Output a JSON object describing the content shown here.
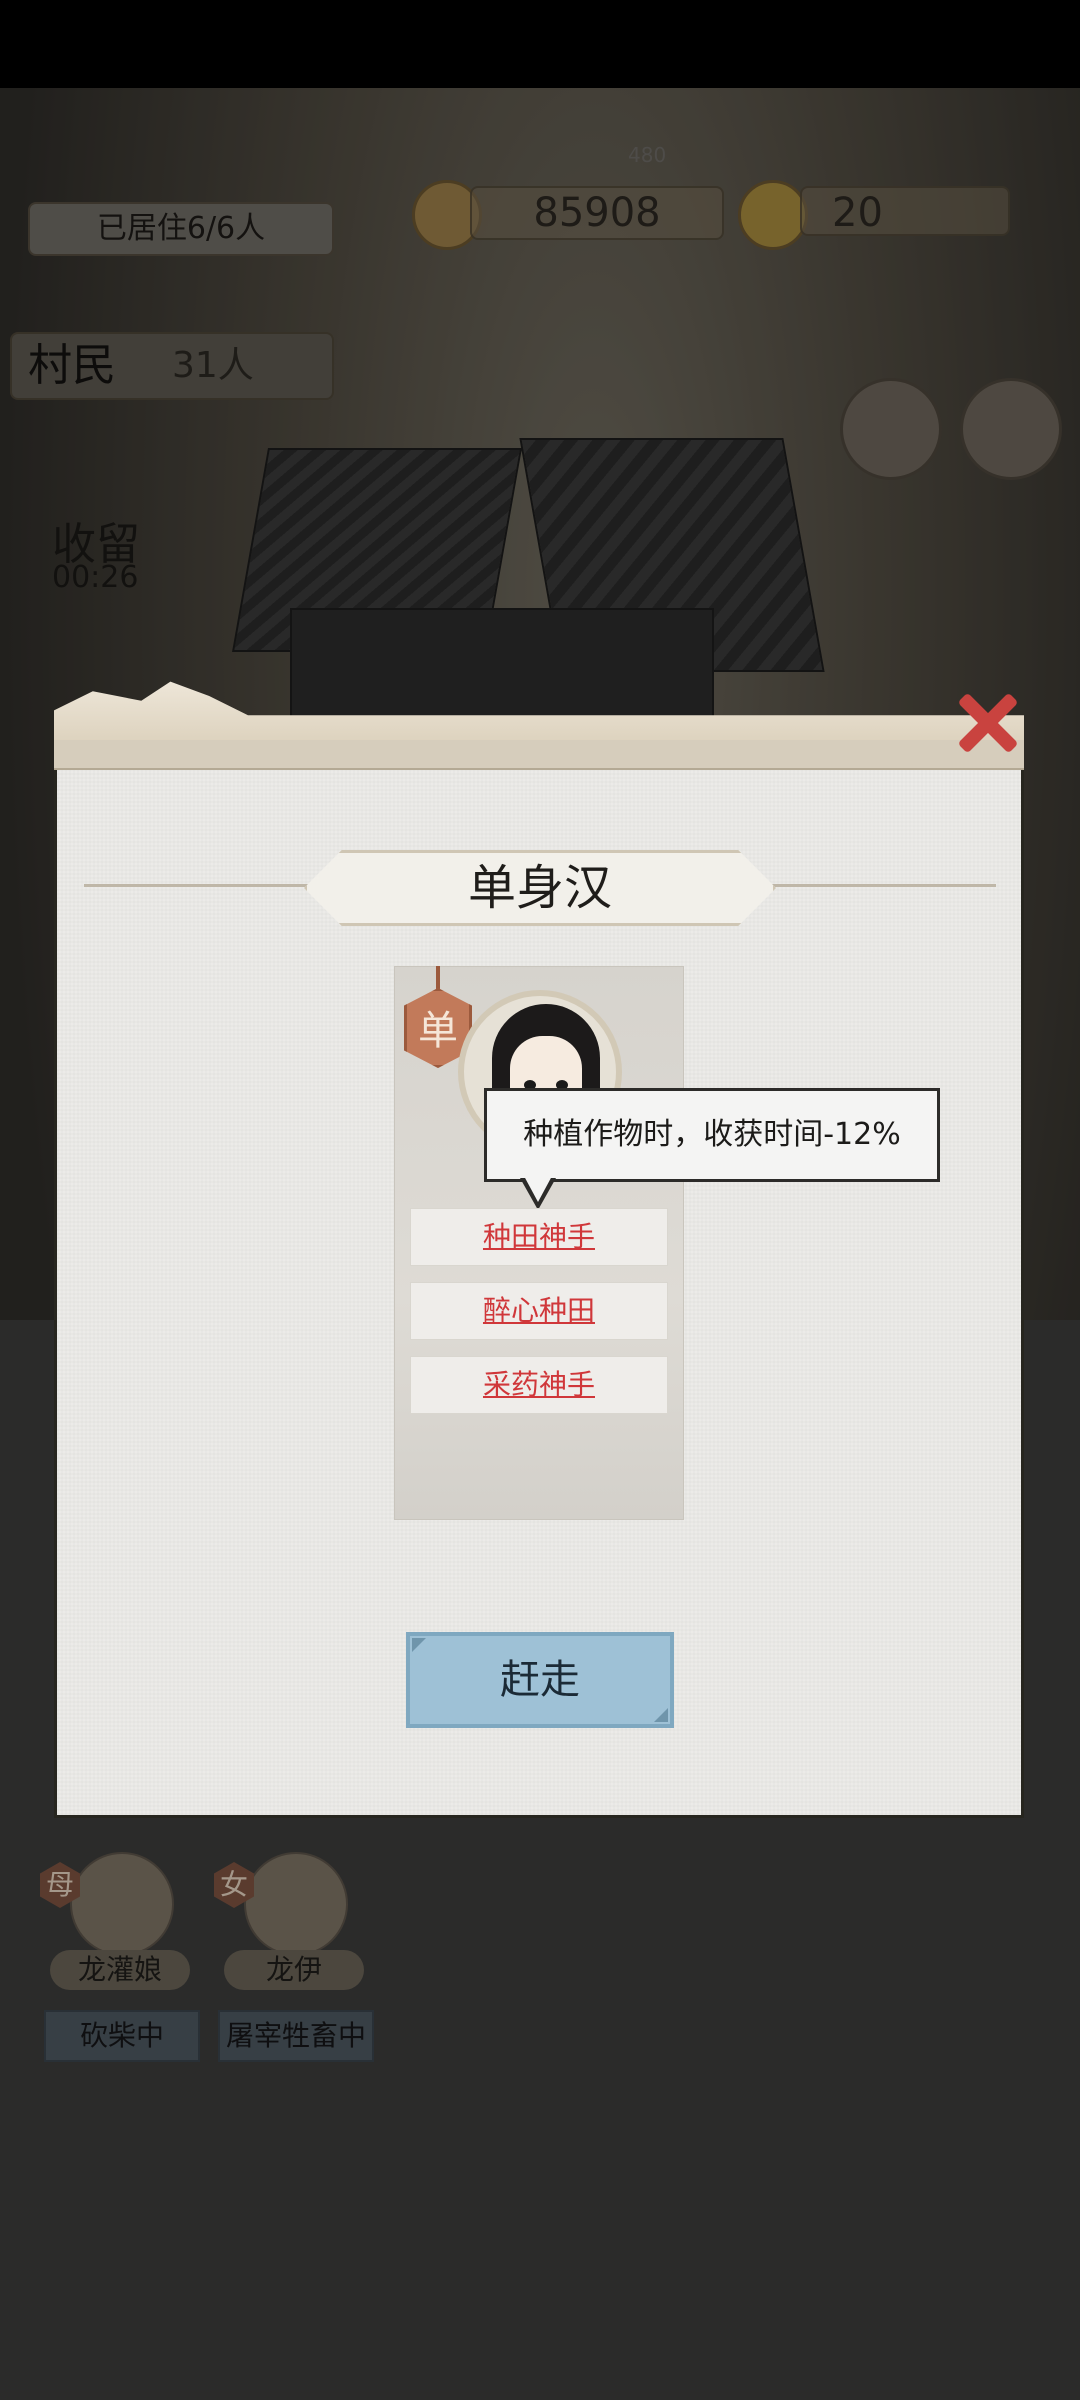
{
  "hud": {
    "residents": "已居住6/6人",
    "currency_top": "480",
    "copper_amount": "85908",
    "gold_amount": "20",
    "villager_label": "村民",
    "villager_count": "31人",
    "shelter_label": "收留",
    "shelter_timer": "00:26"
  },
  "background_villagers": [
    {
      "badge": "母",
      "name": "龙灌娘",
      "status": "砍柴中"
    },
    {
      "badge": "女",
      "name": "龙伊",
      "status": "屠宰牲畜中"
    }
  ],
  "modal": {
    "title": "单身汉",
    "badge": "单",
    "tooltip": "种植作物时，收获时间-12%",
    "traits": [
      "种田神手",
      "醉心种田",
      "采药神手"
    ],
    "action_label": "赶走"
  },
  "colors": {
    "trait_text": "#d0373a",
    "action_button": "#9ec1d6",
    "close_button": "#c9433f",
    "badge": "#c27a5a"
  },
  "icons": {
    "close": "close-icon",
    "copper": "copper-coin-icon",
    "gold": "gold-ingot-icon",
    "settings": "gear-icon",
    "book": "book-icon"
  }
}
